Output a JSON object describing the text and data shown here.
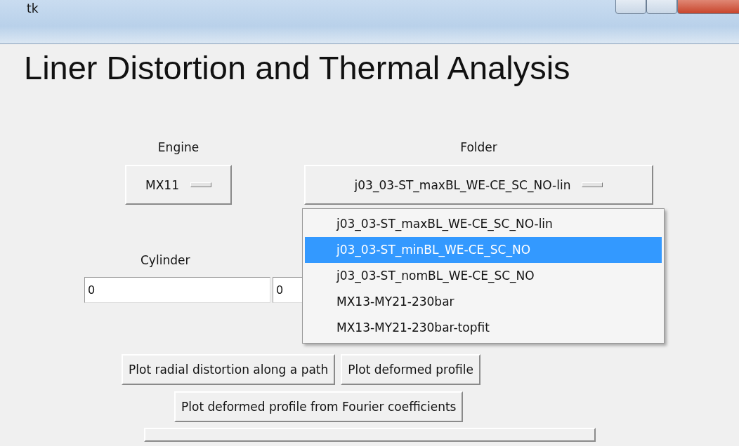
{
  "window": {
    "title": "tk"
  },
  "heading": "Liner Distortion and Thermal Analysis",
  "engine": {
    "label": "Engine",
    "value": "MX11"
  },
  "folder": {
    "label": "Folder",
    "value": "j03_03-ST_maxBL_WE-CE_SC_NO-lin",
    "menu": {
      "open": true,
      "items": [
        {
          "label": "j03_03-ST_maxBL_WE-CE_SC_NO-lin",
          "selected": false
        },
        {
          "label": "j03_03-ST_minBL_WE-CE_SC_NO",
          "selected": true
        },
        {
          "label": "j03_03-ST_nomBL_WE-CE_SC_NO",
          "selected": false
        },
        {
          "label": "MX13-MY21-230bar",
          "selected": false
        },
        {
          "label": "MX13-MY21-230bar-topfit",
          "selected": false
        }
      ]
    }
  },
  "cylinder": {
    "label": "Cylinder",
    "fields": [
      {
        "value": "0"
      },
      {
        "value": "0"
      }
    ]
  },
  "button_rows": [
    [
      "Plot radial distortion along a path",
      "Plot deformed profile"
    ],
    [
      "Plot deformed profile from Fourier coefficients"
    ]
  ]
}
